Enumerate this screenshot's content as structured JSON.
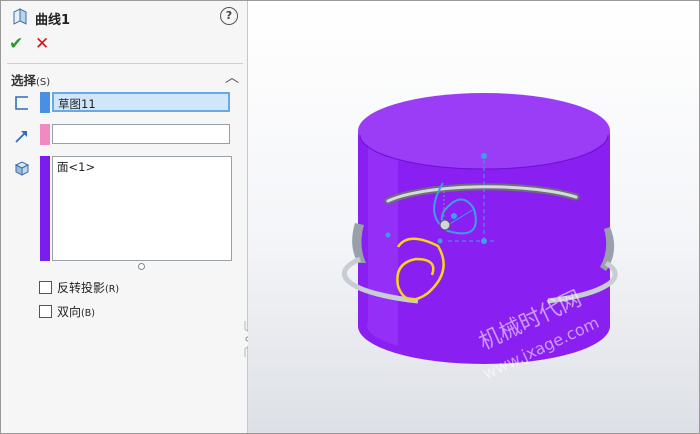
{
  "feature": {
    "title": "曲线1",
    "help": "?",
    "ok": "✔",
    "cancel": "✕"
  },
  "selection": {
    "title": "选择",
    "shortcut": "(S)",
    "collapse": "︿",
    "sketch_field": "草图11",
    "direction_field": "",
    "faces": [
      "面<1>"
    ],
    "colors": {
      "sketch": "#4a90e2",
      "direction": "#f08ac0",
      "faces": "#7a1ef0"
    }
  },
  "options": [
    {
      "label": "反转投影",
      "shortcut": "(R)",
      "checked": false
    },
    {
      "label": "双向",
      "shortcut": "(B)",
      "checked": false
    }
  ],
  "watermark": {
    "line1": "机械时代网",
    "line2": "www.jxage.com"
  }
}
